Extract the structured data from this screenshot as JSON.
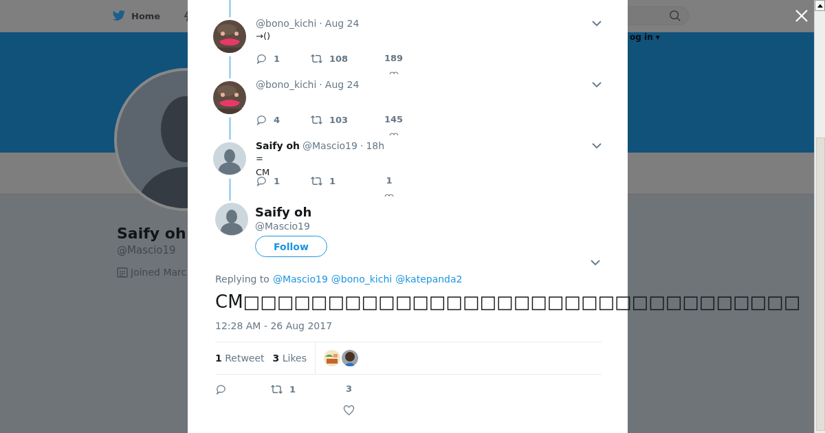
{
  "nav": {
    "home": "Home",
    "login": "og in ▾"
  },
  "profile": {
    "name": "Saify oh",
    "handle": "@Mascio19",
    "joined": "Joined Marc"
  },
  "thread": [
    {
      "handle": "@bono_kichi",
      "separator": "·",
      "time": "Aug 24",
      "text": [
        "→()"
      ],
      "replies": "1",
      "retweets": "108",
      "likes": "189"
    },
    {
      "handle": "@bono_kichi",
      "separator": "·",
      "time": "Aug 24",
      "replies": "4",
      "retweets": "103",
      "likes": "145"
    },
    {
      "kind": "default",
      "name": "Saify oh",
      "handle": "@Mascio19",
      "separator": "·",
      "time": "18h",
      "text": [
        "=",
        "CM"
      ],
      "replies": "1",
      "retweets": "1",
      "likes": "1"
    }
  ],
  "tweet": {
    "name": "Saify oh",
    "handle": "@Mascio19",
    "follow": "Follow",
    "replying_label": "Replying to",
    "replying_to": [
      "@Mascio19",
      "@bono_kichi",
      "@katepanda2"
    ],
    "text": "CM□□□□□□□□□□□□□□□□□□□□□□□□□□□□□□□□□",
    "date": "12:28 AM - 26 Aug 2017",
    "retweet_count": "1",
    "retweet_label": "Retweet",
    "like_count": "3",
    "like_label": "Likes",
    "retweets": "1",
    "likes": "3"
  }
}
